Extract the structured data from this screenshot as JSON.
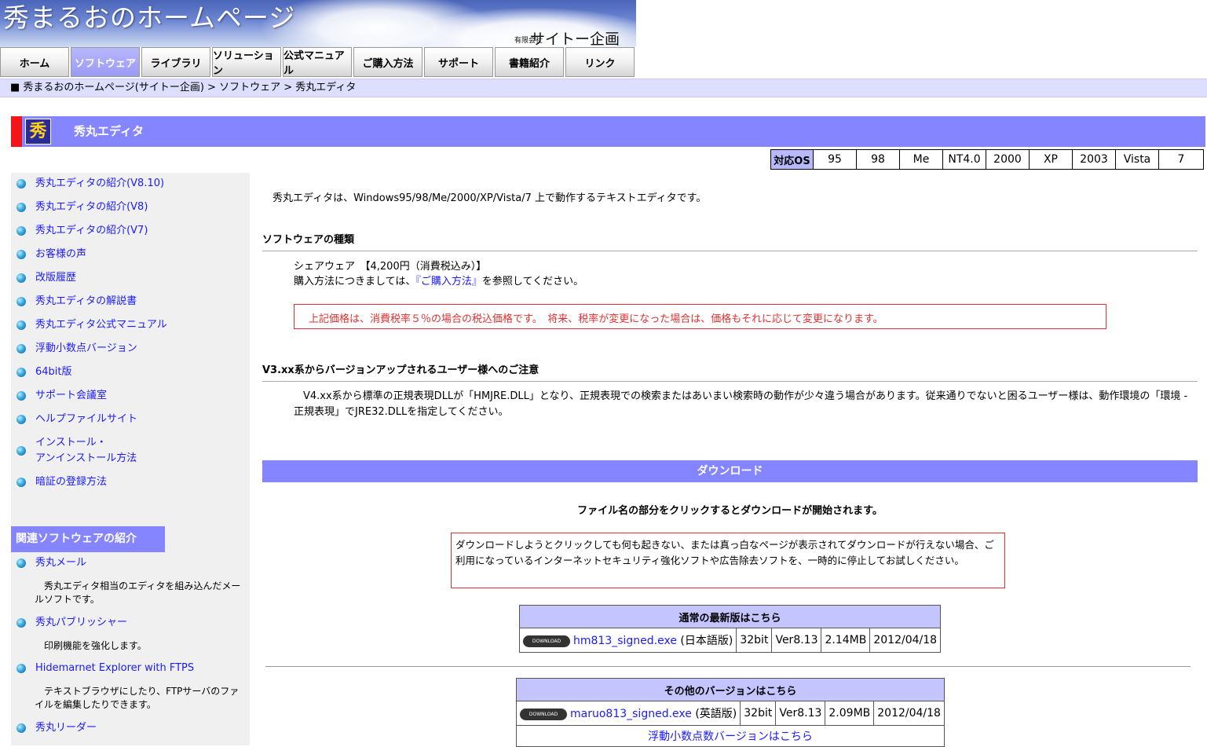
{
  "header": {
    "site_title": "秀まるおのホームページ",
    "company_kind": "有限会社",
    "company_name": "サイトー企画"
  },
  "nav": {
    "tabs": [
      {
        "label": "ホーム"
      },
      {
        "label": "ソフトウェア",
        "active": true
      },
      {
        "label": "ライブラリ"
      },
      {
        "label": "ソリューション"
      },
      {
        "label": "公式マニュアル"
      },
      {
        "label": "ご購入方法"
      },
      {
        "label": "サポート"
      },
      {
        "label": "書籍紹介"
      },
      {
        "label": "リンク"
      }
    ]
  },
  "breadcrumb": "■ 秀まるおのホームページ(サイトー企画) > ソフトウェア > 秀丸エディタ",
  "page": {
    "icon_char": "秀",
    "title": "秀丸エディタ"
  },
  "os_support": {
    "label": "対応OS",
    "versions": [
      "95",
      "98",
      "Me",
      "NT4.0",
      "2000",
      "XP",
      "2003",
      "Vista",
      "7"
    ]
  },
  "sidebar": {
    "items": [
      "秀丸エディタの紹介(V8.10)",
      "秀丸エディタの紹介(V8)",
      "秀丸エディタの紹介(V7)",
      "お客様の声",
      "改版履歴",
      "秀丸エディタの解説書",
      "秀丸エディタ公式マニュアル",
      "浮動小数点バージョン",
      "64bit版",
      "サポート会議室",
      "ヘルプファイルサイト",
      "インストール・\nアンインストール方法",
      "暗証の登録方法"
    ],
    "related_heading": "関連ソフトウェアの紹介",
    "related": [
      {
        "label": "秀丸メール",
        "desc": "秀丸エディタ相当のエディタを組み込んだメールソフトです。"
      },
      {
        "label": "秀丸パブリッシャー",
        "desc": "印刷機能を強化します。"
      },
      {
        "label": "Hidemarnet Explorer with FTPS",
        "desc": "テキストブラウザにしたり、FTPサーバのファイルを編集したりできます。"
      },
      {
        "label": "秀丸リーダー",
        "desc": ""
      }
    ]
  },
  "main": {
    "intro": "秀丸エディタは、Windows95/98/Me/2000/XP/Vista/7 上で動作するテキストエディタです。",
    "software_type_heading": "ソフトウェアの種類",
    "price_line": "シェアウェア　【4,200円（消費税込み）】",
    "purchase_prefix": "購入方法につきましては、",
    "purchase_link": "『ご購入方法』",
    "purchase_suffix": "を参照してください。",
    "tax_notice": "上記価格は、消費税率５％の場合の税込価格です。　将来、税率が変更になった場合は、価格もそれに応じて変更になります。",
    "upgrade_heading": "V3.xx系からバージョンアップされるユーザー様へのご注意",
    "upgrade_text_1": "V4.xx系から標準の正規表現DLLが「HMJRE.DLL」となり、正規表現での検索またはあいまい検索時の動作が少々違う場合があります。従来通りでないと困るユーザー様は、動作環境の「環境 -",
    "upgrade_text_2": "正規表現」でJRE32.DLLを指定してください。",
    "download_heading": "ダウンロード",
    "download_hint": "ファイル名の部分をクリックするとダウンロードが開始されます。",
    "download_warning": "ダウンロードしようとクリックしても何も起きない、または真っ白なページが表示されてダウンロードが行えない場合、ご利用になっているインターネットセキュリティ強化ソフトや広告除去ソフトを、一時的に停止してお試しください。",
    "download_button_label": "DOWNLOAD",
    "latest": {
      "heading": "通常の最新版はこちら",
      "file": "hm813_signed.exe",
      "lang": "(日本語版)",
      "arch": "32bit",
      "version": "Ver8.13",
      "size": "2.14MB",
      "date": "2012/04/18"
    },
    "others": {
      "heading": "その他のバージョンはこちら",
      "file": "maruo813_signed.exe",
      "lang": "(英語版)",
      "arch": "32bit",
      "version": "Ver8.13",
      "size": "2.09MB",
      "date": "2012/04/18",
      "float_link": "浮動小数点数バージョンはこちら"
    }
  },
  "colors": {
    "accent": "#8585ff",
    "breadcrumb_bg": "#dedeff",
    "link": "#1a1aff",
    "notice_red": "#e23030"
  }
}
